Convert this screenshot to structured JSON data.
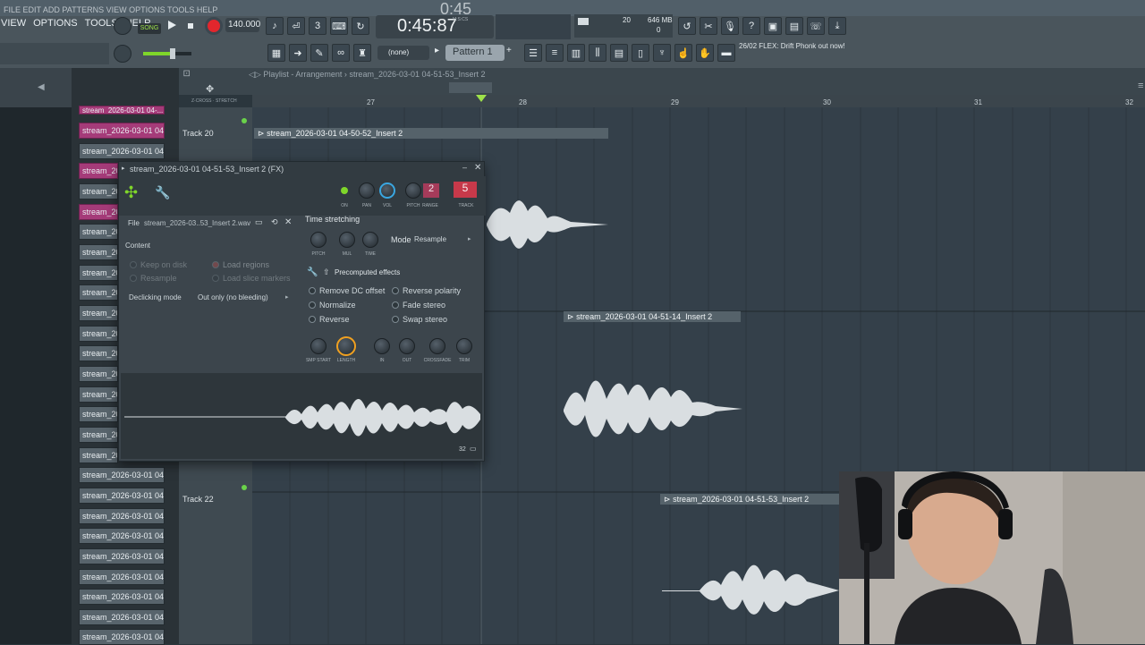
{
  "menu": {
    "items": [
      "VIEW",
      "OPTIONS",
      "TOOLS",
      "HELP"
    ],
    "ghost_items": [
      "FILE",
      "EDIT",
      "ADD",
      "PATTERNS",
      "VIEW",
      "OPTIONS",
      "TOOLS",
      "HELP"
    ]
  },
  "transport": {
    "song_label": "SONG",
    "tempo": "140.000",
    "time": "0:45:87",
    "time_unit": "M:S:CS",
    "ghost_time": "0:45"
  },
  "monitor": {
    "cpu_value": "20",
    "ram": "646 MB",
    "ram_low": "0"
  },
  "pattern": {
    "none_label": "(none)",
    "pattern_label": "Pattern 1"
  },
  "news": {
    "date": "26/02",
    "text": "FLEX: Drift Phonk out now!"
  },
  "playlist": {
    "breadcrumb": "Playlist - Arrangement",
    "breadcrumb_sep": "›",
    "breadcrumb_item": "stream_2026-03-01 04-51-53_Insert 2",
    "ruler_marks": [
      "27",
      "28",
      "29",
      "30",
      "31",
      "32"
    ],
    "tracks": [
      "Track 20",
      "Track 22"
    ],
    "clips": [
      "stream_2026-03-01 04-50-52_Insert 2",
      "stream_2026-03-01 04-51-14_Insert 2",
      "stream_2026-03-01 04-51-53_Insert 2"
    ]
  },
  "picker": {
    "clip_label": "stream_2026-03-01 04-...",
    "clip_short": "stream_202",
    "top_clip": "stream_2026-03-01 04-..."
  },
  "fx": {
    "title": "stream_2026-03-01 04-51-53_Insert 2 (FX)",
    "file_label": "File",
    "file_name": "stream_2026-03..53_Insert 2.wav",
    "content_label": "Content",
    "keep_on_disk": "Keep on disk",
    "resample": "Resample",
    "load_regions": "Load regions",
    "load_slice": "Load slice markers",
    "declicking_label": "Declicking mode",
    "declicking_value": "Out only (no bleeding)",
    "knob_labels": [
      "ON",
      "PAN",
      "VOL",
      "PITCH",
      "RANGE",
      "TRACK"
    ],
    "range_value": "2",
    "track_value": "5",
    "time_stretching": "Time stretching",
    "ts_knobs": [
      "PITCH",
      "MUL",
      "TIME"
    ],
    "mode_label": "Mode",
    "mode_value": "Resample",
    "precomputed": "Precomputed effects",
    "effects_left": [
      "Remove DC offset",
      "Normalize",
      "Reverse"
    ],
    "effects_right": [
      "Reverse polarity",
      "Fade stereo",
      "Swap stereo"
    ],
    "bottom_knobs": [
      "SMP START",
      "LENGTH",
      "IN",
      "OUT",
      "CROSSFADE",
      "TRIM"
    ],
    "zoom": "32"
  },
  "colors": {
    "accent_pink": "#a53b79",
    "record_red": "#e2262d",
    "song_green": "#7fd62a",
    "knob_orange": "#f0a020",
    "knob_blue": "#3aa6e0"
  }
}
